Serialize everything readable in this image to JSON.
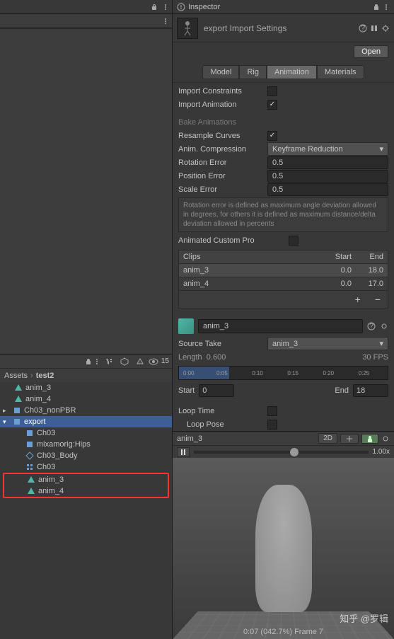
{
  "inspector": {
    "title": "Inspector",
    "asset_title": "export Import Settings",
    "open_btn": "Open"
  },
  "tabs": {
    "model": "Model",
    "rig": "Rig",
    "animation": "Animation",
    "materials": "Materials"
  },
  "props": {
    "import_constraints": "Import Constraints",
    "import_animation": "Import Animation",
    "bake_animations": "Bake Animations",
    "resample_curves": "Resample Curves",
    "anim_compression": "Anim. Compression",
    "anim_compression_val": "Keyframe Reduction",
    "rotation_error": "Rotation Error",
    "rotation_error_val": "0.5",
    "position_error": "Position Error",
    "position_error_val": "0.5",
    "scale_error": "Scale Error",
    "scale_error_val": "0.5",
    "help_text": "Rotation error is defined as maximum angle deviation allowed in degrees, for others it is defined as maximum distance/delta deviation allowed in percents",
    "animated_custom": "Animated Custom Pro"
  },
  "clips": {
    "header_clips": "Clips",
    "header_start": "Start",
    "header_end": "End",
    "rows": [
      {
        "name": "anim_3",
        "start": "0.0",
        "end": "18.0"
      },
      {
        "name": "anim_4",
        "start": "0.0",
        "end": "17.0"
      }
    ]
  },
  "clip_detail": {
    "name": "anim_3",
    "source_take_label": "Source Take",
    "source_take": "anim_3",
    "length_label": "Length",
    "length_val": "0.600",
    "fps": "30 FPS",
    "ticks": [
      "0:00",
      "0:05",
      "0:10",
      "0:15",
      "0:20",
      "0:25"
    ],
    "start_label": "Start",
    "start_val": "0",
    "end_label": "End",
    "end_val": "18",
    "loop_time": "Loop Time",
    "loop_pose": "Loop Pose"
  },
  "preview": {
    "name": "anim_3",
    "btn_2d": "2D",
    "zoom": "1.00x",
    "frame_info": "0:07 (042.7%) Frame 7"
  },
  "breadcrumb": {
    "root": "Assets",
    "folder": "test2"
  },
  "tree": {
    "anim_3": "anim_3",
    "anim_4": "anim_4",
    "ch03_nonpbr": "Ch03_nonPBR",
    "export": "export",
    "ch03": "Ch03",
    "mixamorig": "mixamorig:Hips",
    "ch03_body": "Ch03_Body",
    "ch03_2": "Ch03",
    "h_anim_3": "anim_3",
    "h_anim_4": "anim_4"
  },
  "toolbar": {
    "count": "15"
  },
  "watermark": "知乎 @罗辑"
}
